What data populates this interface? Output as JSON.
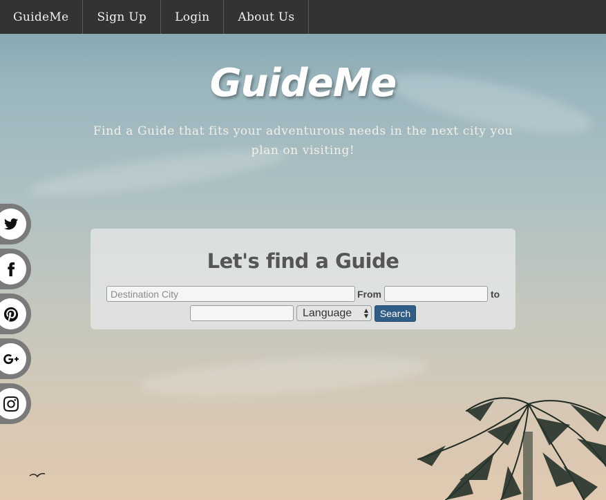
{
  "nav": {
    "items": [
      {
        "label": "GuideMe"
      },
      {
        "label": "Sign Up"
      },
      {
        "label": "Login"
      },
      {
        "label": "About Us"
      }
    ]
  },
  "hero": {
    "title": "GuideMe",
    "subtitle": "Find a Guide that fits your adventurous needs in the next city you plan on visiting!"
  },
  "social": {
    "icons": [
      "twitter-icon",
      "facebook-icon",
      "pinterest-icon",
      "google-plus-icon",
      "instagram-icon"
    ]
  },
  "search": {
    "title": "Let's find a Guide",
    "destination_placeholder": "Destination City",
    "destination_value": "",
    "from_label": "From",
    "from_value": "",
    "to_label": "to",
    "to_value": "",
    "language_selected": "Language",
    "search_button": "Search"
  },
  "colors": {
    "navbar": "#333333",
    "search_button": "#2f5d85"
  }
}
